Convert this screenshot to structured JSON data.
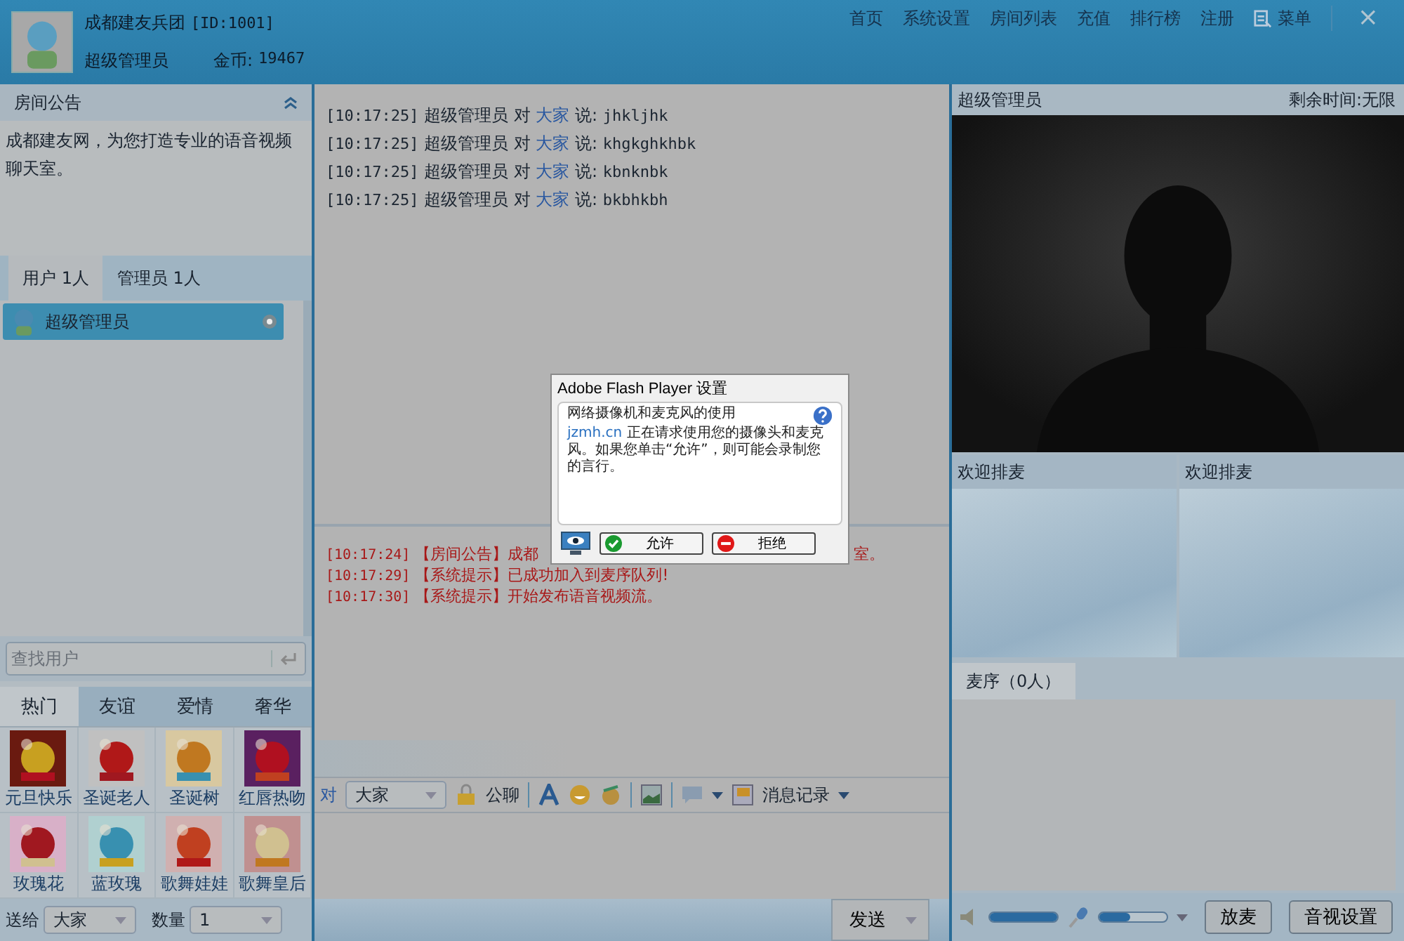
{
  "header": {
    "room_name": "成都建友兵团",
    "room_id": "[ID:1001]",
    "user_name": "超级管理员",
    "coins_label": "金币:",
    "coins": "19467",
    "nav": [
      {
        "label": "首页",
        "kind": "link"
      },
      {
        "label": "系统设置",
        "kind": "link"
      },
      {
        "label": "房间列表",
        "kind": "link"
      },
      {
        "label": "充值",
        "kind": "link"
      },
      {
        "label": "排行榜",
        "kind": "link"
      },
      {
        "label": "注册",
        "kind": "link"
      },
      {
        "label": "菜单",
        "kind": "menu"
      }
    ],
    "close": "×"
  },
  "notice": {
    "title": "房间公告",
    "text": "成都建友网，为您打造专业的语音视频聊天室。"
  },
  "user_tabs": [
    {
      "label": "用户 1人",
      "selected": true
    },
    {
      "label": "管理员 1人",
      "selected": false
    }
  ],
  "users": [
    {
      "name": "超级管理员",
      "selected": true
    }
  ],
  "search": {
    "placeholder": "查找用户"
  },
  "gift_tabs": [
    {
      "label": "热门",
      "selected": true
    },
    {
      "label": "友谊",
      "selected": false
    },
    {
      "label": "爱情",
      "selected": false
    },
    {
      "label": "奢华",
      "selected": false
    }
  ],
  "gifts": [
    {
      "label": "元旦快乐"
    },
    {
      "label": "圣诞老人"
    },
    {
      "label": "圣诞树"
    },
    {
      "label": "红唇热吻"
    },
    {
      "label": "玫瑰花"
    },
    {
      "label": "蓝玫瑰"
    },
    {
      "label": "歌舞娃娃"
    },
    {
      "label": "歌舞皇后"
    }
  ],
  "gift_bar": {
    "to_label": "送给",
    "to_value": "大家",
    "count_label": "数量",
    "count_value": "1"
  },
  "messages": [
    {
      "time": "[10:17:25]",
      "user": "超级管理员",
      "to_word": "对",
      "target": "大家",
      "said": "说:",
      "text": "jhkljhk"
    },
    {
      "time": "[10:17:25]",
      "user": "超级管理员",
      "to_word": "对",
      "target": "大家",
      "said": "说:",
      "text": "khgkghkhbk"
    },
    {
      "time": "[10:17:25]",
      "user": "超级管理员",
      "to_word": "对",
      "target": "大家",
      "said": "说:",
      "text": "kbnknbk"
    },
    {
      "time": "[10:17:25]",
      "user": "超级管理员",
      "to_word": "对",
      "target": "大家",
      "said": "说:",
      "text": "bkbhkbh"
    }
  ],
  "system_messages": [
    {
      "time": "[10:17:24]",
      "tag": "【房间公告】",
      "text": "成都",
      "tail": "室。"
    },
    {
      "time": "[10:17:29]",
      "tag": "【系统提示】",
      "text": "已成功加入到麦序队列!"
    },
    {
      "time": "[10:17:30]",
      "tag": "【系统提示】",
      "text": "开始发布语音视频流。"
    }
  ],
  "toolbar": {
    "to_word": "对",
    "target": "大家",
    "public_chat": "公聊",
    "history": "消息记录"
  },
  "send": "发送",
  "video": {
    "name": "超级管理员",
    "time_left": "剩余时间:无限"
  },
  "queue_slots": [
    {
      "title": "欢迎排麦"
    },
    {
      "title": "欢迎排麦"
    }
  ],
  "queue_tab": {
    "label": "麦序（0人）",
    "selected": true
  },
  "audio": {
    "speaker": {
      "level": 1.0
    },
    "mic": {
      "level": 0.45
    },
    "release": "放麦",
    "settings": "音视设置"
  },
  "dialog": {
    "title": "Adobe Flash Player 设置",
    "heading": "网络摄像机和麦克风的使用",
    "site": "jzmh.cn",
    "message": " 正在请求使用您的摄像头和麦克风。如果您单击“允许”，则可能会录制您的言行。",
    "allow": "允许",
    "deny": "拒绝"
  }
}
